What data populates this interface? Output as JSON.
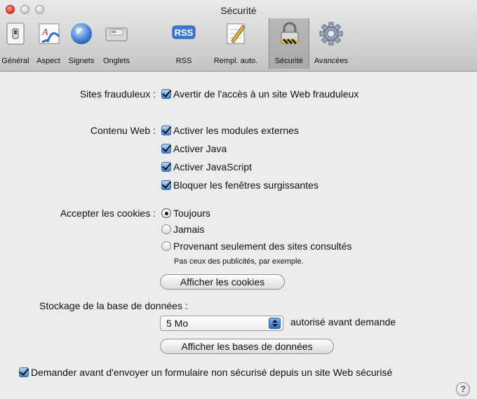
{
  "window": {
    "title": "Sécurité"
  },
  "toolbar": {
    "items": [
      {
        "label": "Général",
        "icon": "light-switch-icon"
      },
      {
        "label": "Aspect",
        "icon": "font-icon"
      },
      {
        "label": "Signets",
        "icon": "globe-icon"
      },
      {
        "label": "Onglets",
        "icon": "tabs-icon"
      },
      {
        "label": "RSS",
        "icon": "rss-icon",
        "badge": "RSS"
      },
      {
        "label": "Rempl. auto.",
        "icon": "pencil-form-icon"
      },
      {
        "label": "Sécurité",
        "icon": "lock-icon",
        "selected": true
      },
      {
        "label": "Avancées",
        "icon": "gear-icon"
      }
    ]
  },
  "security": {
    "fraud": {
      "label": "Sites frauduleux :",
      "option": "Avertir de l'accès à un site Web frauduleux",
      "checked": true
    },
    "web_content": {
      "label": "Contenu Web :",
      "options": [
        {
          "text": "Activer les modules externes",
          "checked": true
        },
        {
          "text": "Activer Java",
          "checked": true
        },
        {
          "text": "Activer JavaScript",
          "checked": true
        },
        {
          "text": "Bloquer les fenêtres surgissantes",
          "checked": true
        }
      ]
    },
    "cookies": {
      "label": "Accepter les cookies :",
      "options": [
        {
          "text": "Toujours",
          "selected": true
        },
        {
          "text": "Jamais",
          "selected": false
        },
        {
          "text": "Provenant seulement des sites consultés",
          "selected": false
        }
      ],
      "hint": "Pas ceux des publicités, par exemple.",
      "show_button": "Afficher les cookies"
    },
    "database": {
      "label": "Stockage de la base de données :",
      "value": "5 Mo",
      "suffix": "autorisé avant demande",
      "show_button": "Afficher les bases de données"
    },
    "insecure_form": {
      "text": "Demander avant d'envoyer un formulaire non sécurisé depuis un site Web sécurisé",
      "checked": true
    },
    "help": "?"
  },
  "colors": {
    "accent": "#3f7fd2",
    "window_bg": "#ececec"
  }
}
